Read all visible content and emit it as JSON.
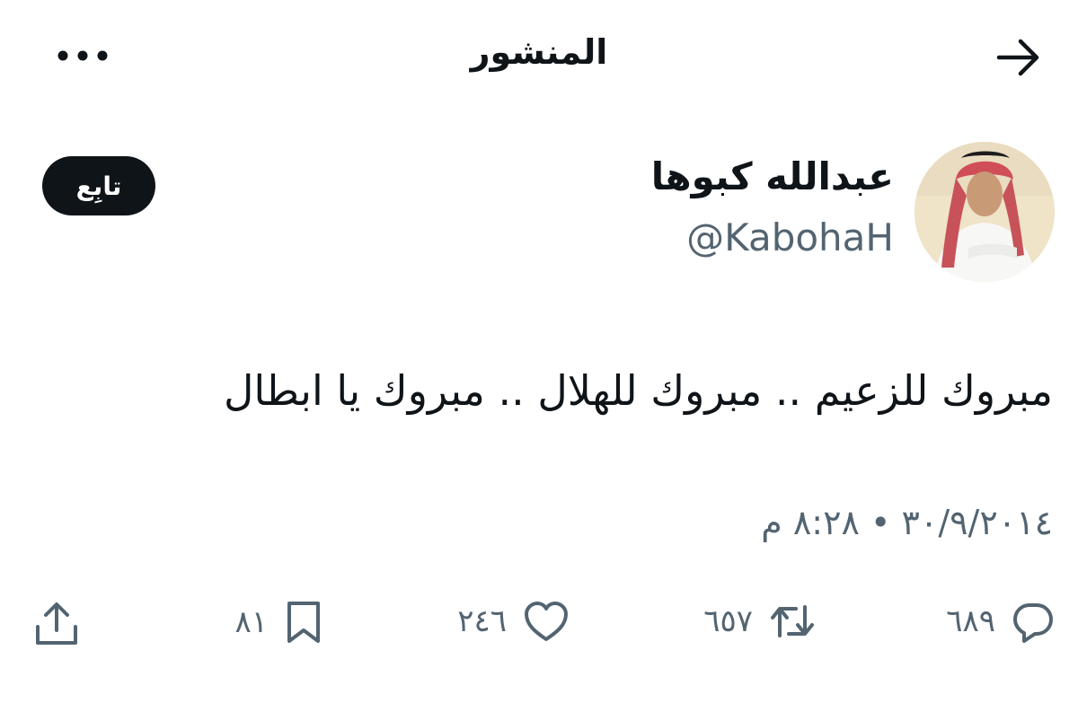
{
  "header": {
    "title": "المنشور",
    "back_icon": "arrow-right-icon",
    "more_icon": "more-horizontal-icon"
  },
  "author": {
    "name": "عبدالله كبوها",
    "handle": "@KabohaH",
    "avatar_icon": "profile-photo"
  },
  "follow_button": {
    "label": "تابِع"
  },
  "tweet": {
    "text": "مبروك للزعيم .. مبروك للهلال .. مبروك يا ابطال",
    "timestamp": "٣٠/٩/٢٠١٤ ‏• ٨:٢٨ م"
  },
  "actions": {
    "replies": "٦٨٩",
    "retweets": "٦٥٧",
    "likes": "٢٤٦",
    "bookmarks": "٨١",
    "reply_icon": "reply-icon",
    "retweet_icon": "retweet-icon",
    "like_icon": "heart-icon",
    "bookmark_icon": "bookmark-icon",
    "share_icon": "share-icon"
  },
  "colors": {
    "text": "#0f1419",
    "secondary": "#536471",
    "background": "#ffffff",
    "follow_bg": "#0f1419"
  }
}
